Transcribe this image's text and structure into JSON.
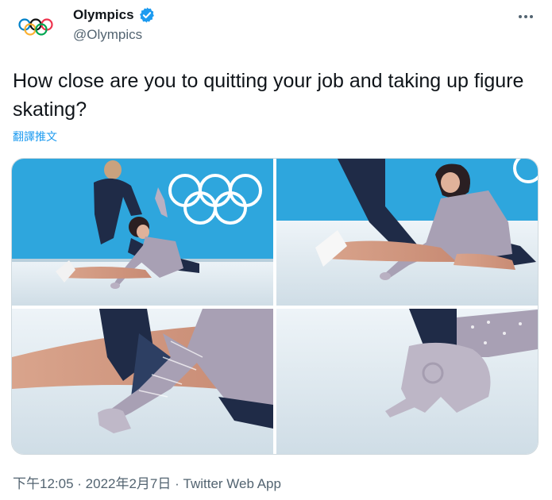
{
  "account": {
    "display_name": "Olympics",
    "handle": "@Olympics",
    "verified": true,
    "avatar_icon": "olympic-rings-icon"
  },
  "tweet": {
    "text": "How close are you to quitting your job and taking up figure skating?",
    "translate_label": "翻譯推文"
  },
  "media": {
    "photo_count": 4
  },
  "meta": {
    "time": "下午12:05",
    "separator": " · ",
    "date": "2022年2月7日",
    "source": "Twitter Web App"
  },
  "colors": {
    "accent": "#1d9bf0",
    "secondary_text": "#536471",
    "ice": "#dde8ef",
    "rink_board": "#2ea6dd",
    "costume": "#a8a0b4"
  }
}
